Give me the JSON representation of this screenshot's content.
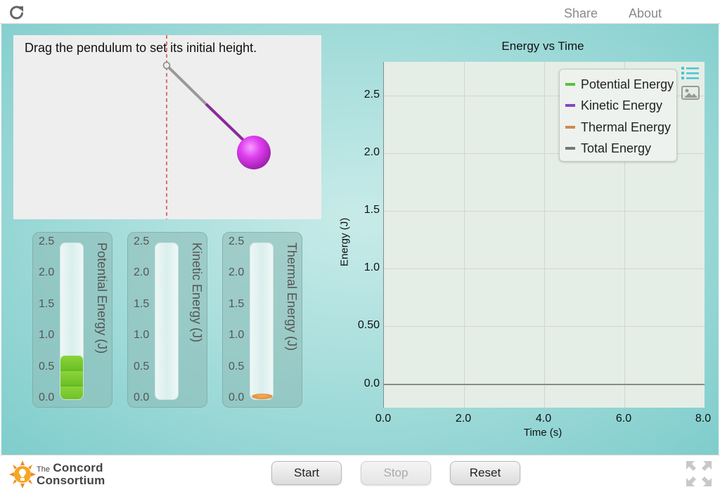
{
  "header": {
    "reload_icon": "reload-icon",
    "share_label": "Share",
    "about_label": "About"
  },
  "pendulum": {
    "instruction": "Drag the pendulum to set its initial height.",
    "rod_color": "#999999",
    "bob_color": "#cc33dd",
    "reference_line_color": "#cc2222"
  },
  "energy_bars": {
    "ticks": [
      "2.5",
      "2.0",
      "1.5",
      "1.0",
      "0.5",
      "0.0"
    ],
    "max": 2.5,
    "bars": [
      {
        "label": "Potential Energy (J)",
        "value": 0.7,
        "color": "#6cc026"
      },
      {
        "label": "Kinetic Energy (J)",
        "value": 0.0,
        "color": "#8a44c4"
      },
      {
        "label": "Thermal Energy (J)",
        "value": 0.0,
        "color": "#d9822b"
      }
    ]
  },
  "chart_data": {
    "type": "line",
    "title": "Energy vs Time",
    "xlabel": "Time (s)",
    "ylabel": "Energy (J)",
    "xlim": [
      0,
      8
    ],
    "ylim": [
      -0.2,
      2.7
    ],
    "x_ticks": [
      "0.0",
      "2.0",
      "4.0",
      "6.0",
      "8.0"
    ],
    "y_ticks": [
      "0.0",
      "0.50",
      "1.0",
      "1.5",
      "2.0",
      "2.5"
    ],
    "grid": true,
    "legend_position": "top-right",
    "series": [
      {
        "name": "Potential Energy",
        "color": "#5cbf3f",
        "x": [],
        "y": []
      },
      {
        "name": "Kinetic Energy",
        "color": "#8a44c4",
        "x": [],
        "y": []
      },
      {
        "name": "Thermal Energy",
        "color": "#d08a50",
        "x": [],
        "y": []
      },
      {
        "name": "Total Energy",
        "color": "#777777",
        "x": [
          0,
          8
        ],
        "y": [
          0,
          0
        ]
      }
    ]
  },
  "graph_icons": {
    "legend_icon": "list-icon",
    "snapshot_icon": "image-icon"
  },
  "footer": {
    "logo_small": "The",
    "logo_line1": "Concord",
    "logo_line2": "Consortium",
    "start_label": "Start",
    "stop_label": "Stop",
    "reset_label": "Reset",
    "fullscreen_icon": "fullscreen-icon"
  }
}
